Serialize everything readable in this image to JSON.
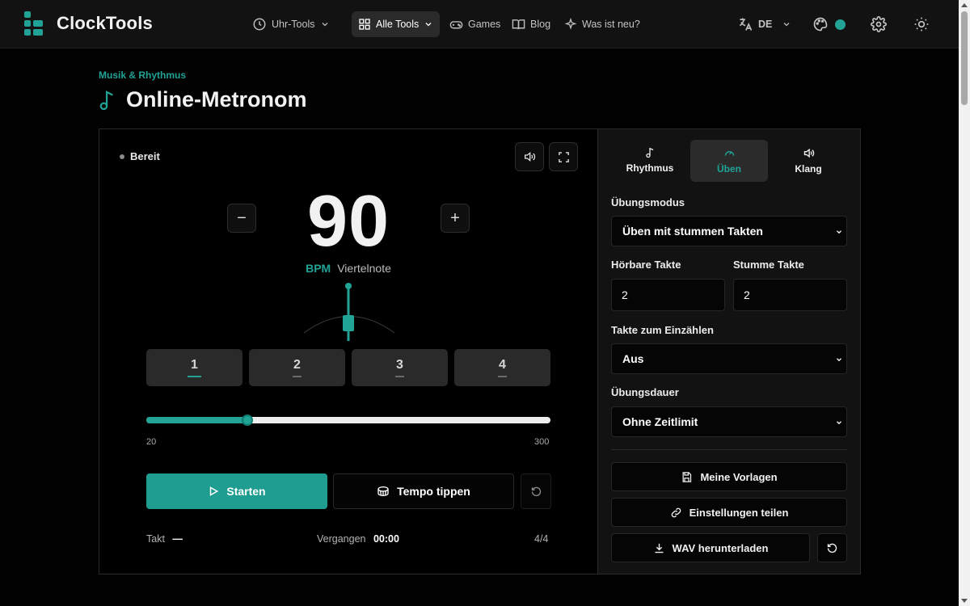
{
  "nav": {
    "brand": "ClockTools",
    "items": [
      {
        "label": "Uhr-Tools",
        "icon": "clock-icon"
      },
      {
        "label": "Alle Tools",
        "icon": "grid-icon"
      },
      {
        "label": "Games",
        "icon": "gamepad-icon"
      },
      {
        "label": "Blog",
        "icon": "book-icon"
      },
      {
        "label": "Was ist neu?",
        "icon": "sparkles-icon"
      }
    ],
    "language": "DE",
    "accent_color": "#21a396"
  },
  "page": {
    "breadcrumb": "Musik & Rhythmus",
    "title": "Online-Metronom"
  },
  "metronome": {
    "status": "Bereit",
    "bpm": "90",
    "bpm_unit": "BPM",
    "note_value": "Viertelnote",
    "beats": [
      "1",
      "2",
      "3",
      "4"
    ],
    "current_beat": 1,
    "slider": {
      "min": "20",
      "max": "300",
      "value": 90
    },
    "start_label": "Starten",
    "tap_label": "Tempo tippen",
    "bar_label": "Takt",
    "bar_value": "—",
    "elapsed_label": "Vergangen",
    "elapsed_value": "00:00",
    "time_signature": "4/4"
  },
  "settings": {
    "tabs": [
      "Rhythmus",
      "Üben",
      "Klang"
    ],
    "active_tab": "Üben",
    "practice_mode_label": "Übungsmodus",
    "practice_mode_value": "Üben mit stummen Takten",
    "audible_bars_label": "Hörbare Takte",
    "audible_bars_value": "2",
    "muted_bars_label": "Stumme Takte",
    "muted_bars_value": "2",
    "count_in_label": "Takte zum Einzählen",
    "count_in_value": "Aus",
    "duration_label": "Übungsdauer",
    "duration_value": "Ohne Zeitlimit",
    "presets_label": "Meine Vorlagen",
    "share_label": "Einstellungen teilen",
    "download_label": "WAV herunterladen"
  }
}
